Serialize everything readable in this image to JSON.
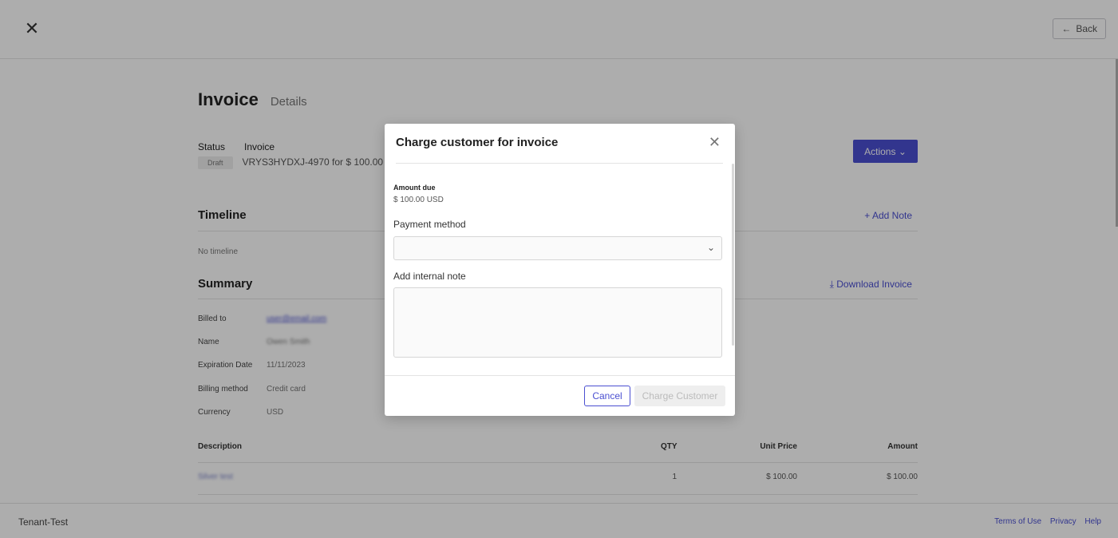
{
  "header": {
    "close_glyph": "✕",
    "back_label": "Back",
    "back_arrow": "←"
  },
  "page": {
    "title": "Invoice",
    "subtitle": "Details",
    "status_label": "Status",
    "invoice_label": "Invoice",
    "status_badge": "Draft",
    "invoice_id": "VRYS3HYDXJ-4970 for $ 100.00",
    "actions_label": "Actions",
    "actions_caret": "⌄"
  },
  "timeline": {
    "title": "Timeline",
    "add_note": "+ Add Note",
    "empty_text": "No timeline"
  },
  "summary": {
    "title": "Summary",
    "download": "⤓ Download Invoice",
    "rows": [
      {
        "key": "Billed to",
        "value": "user@email.com"
      },
      {
        "key": "Name",
        "value": "Owen Smith"
      },
      {
        "key": "Expiration Date",
        "value": "11/11/2023"
      },
      {
        "key": "Billing method",
        "value": "Credit card"
      },
      {
        "key": "Currency",
        "value": "USD"
      }
    ]
  },
  "table": {
    "headers": {
      "description": "Description",
      "qty": "QTY",
      "unit_price": "Unit Price",
      "amount": "Amount"
    },
    "rows": [
      {
        "description": "Silver test",
        "qty": "1",
        "unit_price": "$ 100.00",
        "amount": "$ 100.00"
      }
    ]
  },
  "footer": {
    "tenant": "Tenant-Test",
    "links": [
      "Terms of Use",
      "Privacy",
      "Help"
    ]
  },
  "modal": {
    "title": "Charge customer for invoice",
    "close_glyph": "✕",
    "amount_due_label": "Amount due",
    "amount_due_value": "$ 100.00 USD",
    "payment_method_label": "Payment method",
    "payment_method_value": "",
    "note_label": "Add internal note",
    "note_value": "",
    "cancel_label": "Cancel",
    "charge_label": "Charge Customer",
    "select_chevron": "⌄"
  },
  "colors": {
    "accent": "#4a4fd1",
    "overlay": "rgba(0,0,0,0.32)"
  }
}
